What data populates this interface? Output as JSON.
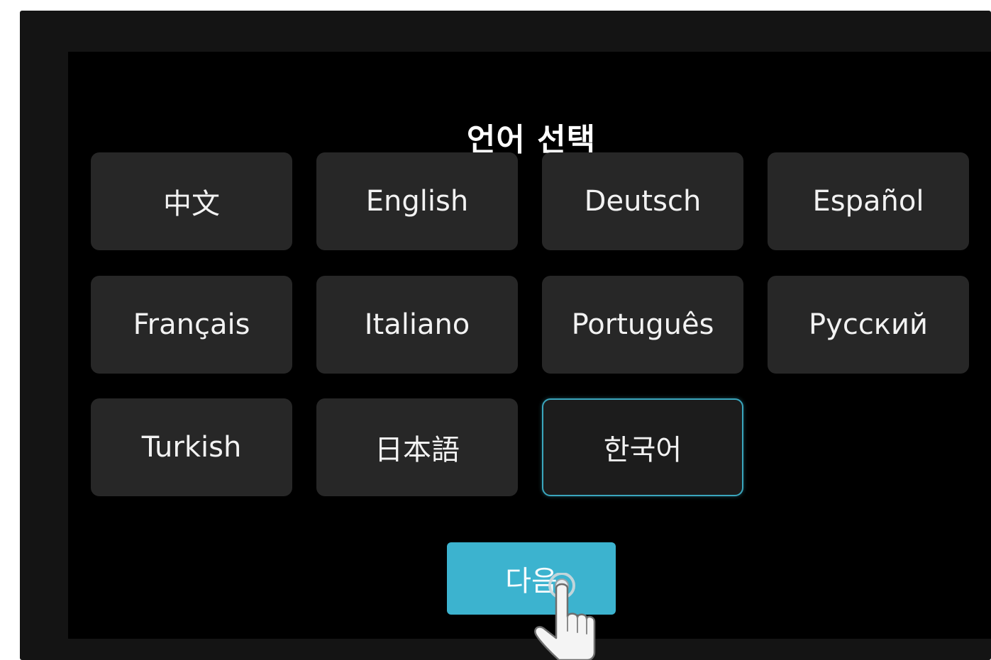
{
  "screen": {
    "title": "언어 선택"
  },
  "languages": [
    {
      "label": "中文",
      "selected": false
    },
    {
      "label": "English",
      "selected": false
    },
    {
      "label": "Deutsch",
      "selected": false
    },
    {
      "label": "Español",
      "selected": false
    },
    {
      "label": "Français",
      "selected": false
    },
    {
      "label": "Italiano",
      "selected": false
    },
    {
      "label": "Português",
      "selected": false
    },
    {
      "label": "Русский",
      "selected": false
    },
    {
      "label": "Turkish",
      "selected": false
    },
    {
      "label": "日本語",
      "selected": false
    },
    {
      "label": "한국어",
      "selected": true
    }
  ],
  "next_button": {
    "label": "다음"
  },
  "colors": {
    "accent": "#3cb3cf",
    "selected_border": "#3aa6bd",
    "button_bg": "#272727",
    "screen_bg": "#000000"
  },
  "icons": {
    "pointer": "hand-pointer-icon"
  }
}
